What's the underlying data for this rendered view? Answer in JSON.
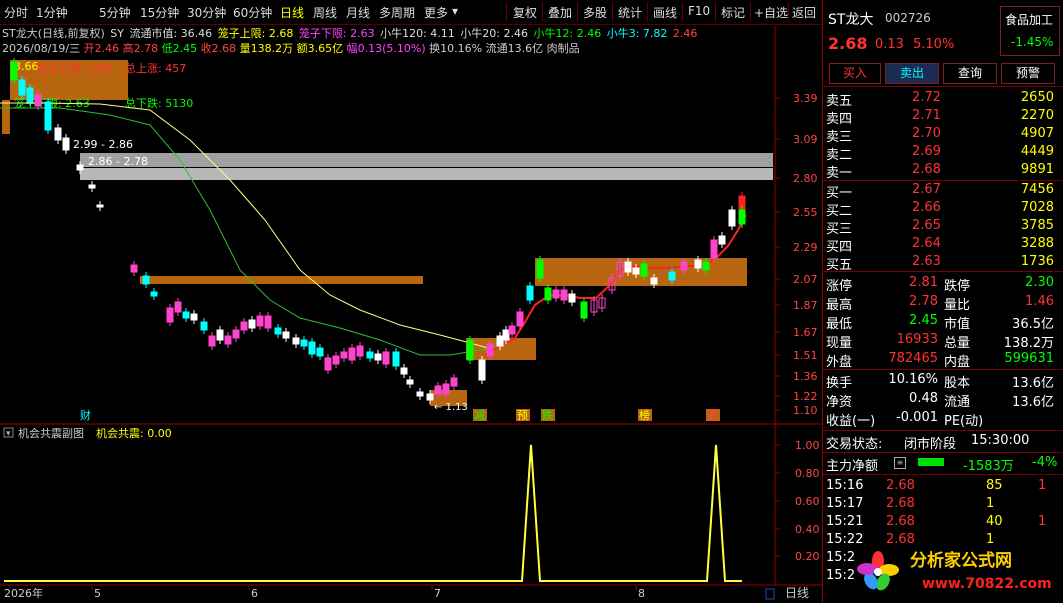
{
  "toolbar": {
    "left": [
      "分时",
      "1分钟",
      "5分钟",
      "15分钟",
      "30分钟",
      "60分钟",
      "日线",
      "周线",
      "月线",
      "多周期",
      "更多"
    ],
    "active": "日线",
    "right": [
      "复权",
      "叠加",
      "多股",
      "统计",
      "画线",
      "F10",
      "标记",
      "+自选",
      "返回"
    ]
  },
  "info": {
    "name": "ST龙大(日线,前复权)",
    "sy": "SY",
    "mcap": "流通市值: 36.46",
    "cage_up": "笼子上限: 2.68",
    "cage_down": "笼子下限: 2.63",
    "n120": "小牛120: 4.11",
    "n20": "小牛20: 2.46",
    "n12": "小牛12: 2.46",
    "n3": "小牛3: 7.82",
    "n3b": "2.46",
    "date": "2026/08/19/三",
    "open": "开2.46",
    "high": "高2.78",
    "low": "低2.45",
    "close": "收2.68",
    "vol": "量138.2万",
    "amt": "额3.65亿",
    "amp": "幅0.13(5.10%)",
    "turn": "换10.16%",
    "float": "流通13.6亿",
    "industry": "肉制品"
  },
  "annotations": {
    "top_price": "3.66",
    "cage_up_label": "笼子上限: 2.68",
    "cage_down_label": "笼子下限: 2.63",
    "total_up": "总上涨: 457",
    "total_down": "总下跌: 5130",
    "range1": "2.99 - 2.86",
    "range2": "2.86 - 2.78",
    "low_mark": "← 1.13",
    "events": [
      "财",
      "减",
      "预",
      "跌",
      "榜",
      "涨"
    ]
  },
  "yaxis_main": [
    "3.39",
    "3.09",
    "2.80",
    "2.55",
    "2.29",
    "2.07",
    "1.87",
    "1.67",
    "1.51",
    "1.36",
    "1.22",
    "1.10"
  ],
  "subchart": {
    "title": "机会共震副图",
    "value_label": "机会共震: 0.00",
    "yaxis": [
      "1.00",
      "0.80",
      "0.60",
      "0.40",
      "0.20"
    ]
  },
  "xaxis": {
    "labels": [
      "2026年",
      "5",
      "6",
      "7",
      "8"
    ],
    "period": "日线"
  },
  "quote": {
    "name": "ST龙大",
    "code": "002726",
    "sector": "食品加工",
    "sector_pct": "-1.45%",
    "price": "2.68",
    "change": "0.13",
    "pct": "5.10%",
    "buttons": [
      "买入",
      "卖出",
      "查询",
      "预警"
    ]
  },
  "orderbook": {
    "asks": [
      {
        "label": "卖五",
        "price": "2.72",
        "vol": "2650"
      },
      {
        "label": "卖四",
        "price": "2.71",
        "vol": "2270"
      },
      {
        "label": "卖三",
        "price": "2.70",
        "vol": "4907"
      },
      {
        "label": "卖二",
        "price": "2.69",
        "vol": "4449"
      },
      {
        "label": "卖一",
        "price": "2.68",
        "vol": "9891"
      }
    ],
    "bids": [
      {
        "label": "买一",
        "price": "2.67",
        "vol": "7456"
      },
      {
        "label": "买二",
        "price": "2.66",
        "vol": "7028"
      },
      {
        "label": "买三",
        "price": "2.65",
        "vol": "3785"
      },
      {
        "label": "买四",
        "price": "2.64",
        "vol": "3288"
      },
      {
        "label": "买五",
        "price": "2.63",
        "vol": "1736"
      }
    ]
  },
  "stats": [
    {
      "l1": "涨停",
      "v1": "2.81",
      "l2": "跌停",
      "v2": "2.30"
    },
    {
      "l1": "最高",
      "v1": "2.78",
      "l2": "量比",
      "v2": "1.46"
    },
    {
      "l1": "最低",
      "v1": "2.45",
      "l2": "市值",
      "v2": "36.5亿"
    },
    {
      "l1": "现量",
      "v1": "16933",
      "l2": "总量",
      "v2": "138.2万"
    },
    {
      "l1": "外盘",
      "v1": "782465",
      "l2": "内盘",
      "v2": "599631"
    }
  ],
  "stats2": [
    {
      "l1": "换手",
      "v1": "10.16%",
      "l2": "股本",
      "v2": "13.6亿"
    },
    {
      "l1": "净资",
      "v1": "0.48",
      "l2": "流通",
      "v2": "13.6亿"
    },
    {
      "l1": "收益(一)",
      "v1": "-0.001",
      "l2": "PE(动)",
      "v2": ""
    }
  ],
  "trade_state": {
    "label": "交易状态:",
    "state": "闭市阶段",
    "time": "15:30:00"
  },
  "mainflow": {
    "label": "主力净额",
    "value": "-1583万",
    "pct": "-4%"
  },
  "ticks": [
    {
      "t": "15:16",
      "p": "2.68",
      "v": "85",
      "f": "1"
    },
    {
      "t": "15:17",
      "p": "2.68",
      "v": "1",
      "f": ""
    },
    {
      "t": "15:21",
      "p": "2.68",
      "v": "40",
      "f": "1"
    },
    {
      "t": "15:22",
      "p": "2.68",
      "v": "1",
      "f": ""
    },
    {
      "t": "15:2",
      "p": "",
      "v": "",
      "f": ""
    },
    {
      "t": "15:2",
      "p": "",
      "v": "",
      "f": ""
    }
  ],
  "logo": {
    "text": "分析家公式网",
    "url": "www.70822.com"
  },
  "colors": {
    "up": "#ff3333",
    "down": "#00ffff",
    "green": "#00ff00",
    "yellow": "#ffff00",
    "orange": "#b8650f",
    "magenta": "#ff00ff"
  }
}
